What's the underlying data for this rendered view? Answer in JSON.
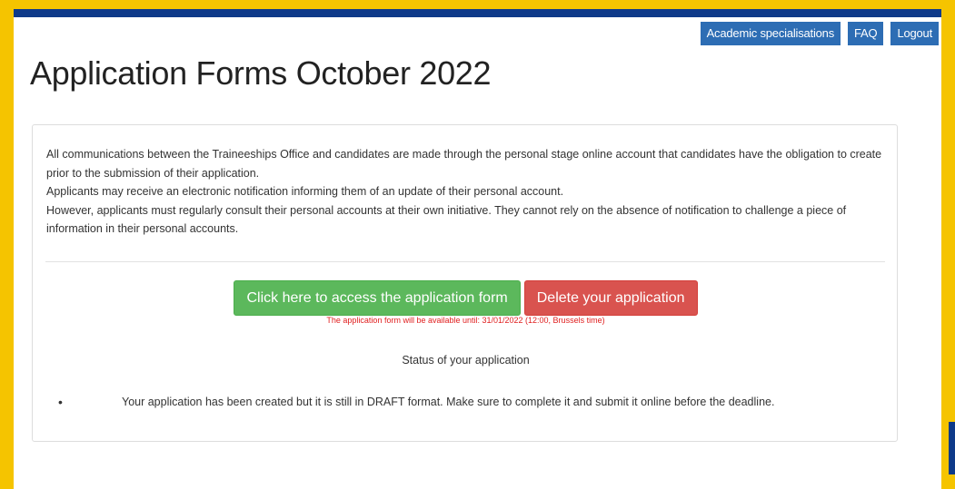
{
  "nav": {
    "academic_label": "Academic specialisations",
    "faq_label": "FAQ",
    "logout_label": "Logout"
  },
  "page": {
    "title": "Application Forms October 2022"
  },
  "notice": {
    "line1": "All communications between the Traineeships Office and candidates are made through the personal stage online account that candidates have the obligation to create prior to the submission of their application.",
    "line2": "Applicants may receive an electronic notification informing them of an update of their personal account.",
    "line3": "However, applicants must regularly consult their personal accounts at their own initiative. They cannot rely on the absence of notification to challenge a piece of information in their personal accounts."
  },
  "actions": {
    "access_label": "Click here to access the application form",
    "delete_label": "Delete your application",
    "availability": "The application form will be available until: 31/01/2022 (12:00, Brussels time)"
  },
  "status": {
    "heading": "Status of your application",
    "bullet": "•",
    "message": "Your application has been created but it is still in DRAFT format. Make sure to complete it and submit it online before the deadline."
  },
  "colors": {
    "frame": "#f5c400",
    "header_bar": "#0e3a89",
    "nav_button": "#2d6db4",
    "access_button": "#5cb85c",
    "delete_button": "#d9534f",
    "availability_text": "#e02020"
  }
}
